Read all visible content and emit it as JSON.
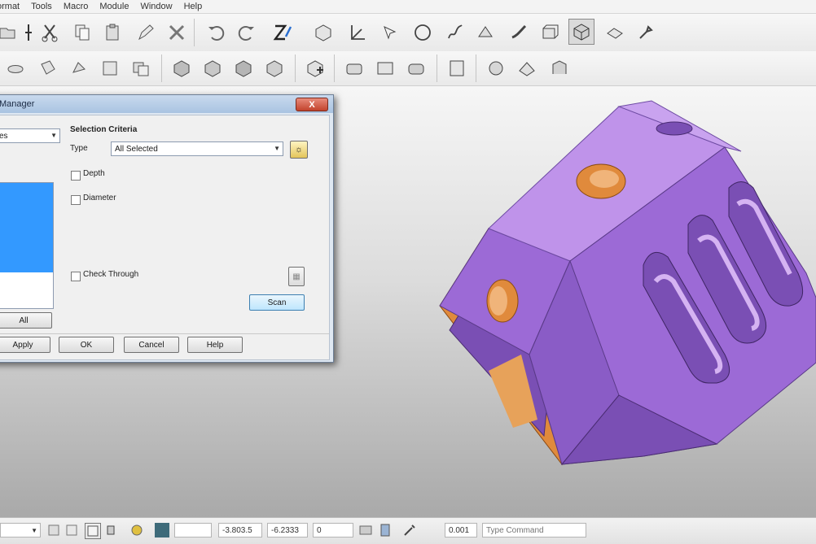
{
  "menu": [
    "ormat",
    "Tools",
    "Macro",
    "Module",
    "Window",
    "Help"
  ],
  "toolbar1_icons": [
    "cut-scissors-icon",
    "copy-icon",
    "paste-icon",
    "edit-pen-icon",
    "delete-x-icon",
    "undo-icon",
    "redo-icon",
    "sketch-z-icon",
    "solid-box-icon",
    "axis-icon",
    "select-arrow-icon",
    "circle-icon",
    "spline-icon",
    "feature-icon",
    "sweep-icon",
    "extrude-icon",
    "view-cube-icon",
    "render-icon",
    "tools-icon"
  ],
  "toolbar2_icons": [
    "shape1-icon",
    "shape2-icon",
    "shape3-icon",
    "shape4-icon",
    "shape5-icon",
    "shape6-icon",
    "shape7-icon",
    "shape8-icon",
    "shape9-icon",
    "shape10-icon",
    "shape11-icon",
    "shape12-icon",
    "shape13-icon",
    "shape14-icon",
    "shape15-icon",
    "shape16-icon",
    "shape17-icon"
  ],
  "dialog": {
    "title": "Manager",
    "close_label": "X",
    "left_dropdown_value": "es",
    "criteria_heading": "Selection Criteria",
    "type_label": "Type",
    "type_value": "All Selected",
    "depth_label": "Depth",
    "diameter_label": "Diameter",
    "check_through_label": "Check Through",
    "scan_label": "Scan",
    "all_label": "All",
    "apply_label": "Apply",
    "ok_label": "OK",
    "cancel_label": "Cancel",
    "help_label": "Help"
  },
  "status": {
    "x_value": "-3.803.5",
    "y_value": "-6.2333",
    "z_value": "0",
    "field_value": "0.001",
    "command_placeholder": "Type Command"
  },
  "colors": {
    "part_face": "#9c6ad6",
    "part_face_light": "#bf93ea",
    "part_face_dark": "#7a4fb4",
    "part_highlight": "#e7a25a",
    "hole_color": "#e08a3c",
    "selection_blue": "#3399ff"
  }
}
